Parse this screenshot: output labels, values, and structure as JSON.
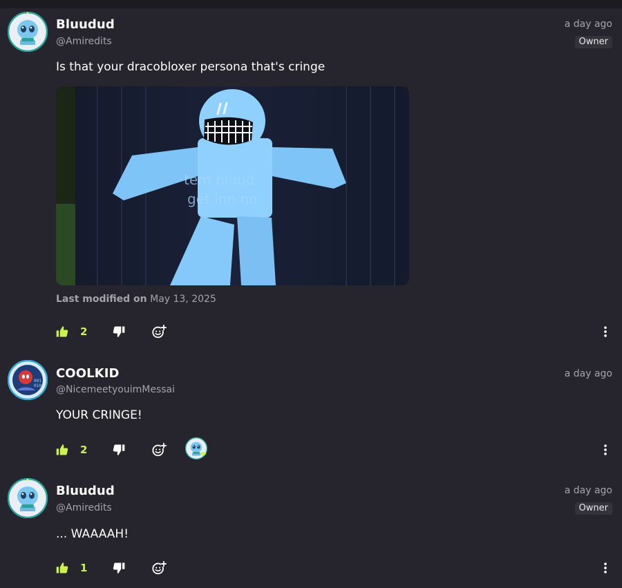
{
  "comments": [
    {
      "username": "Bluudud",
      "handle": "@Amiredits",
      "time": "a day ago",
      "badge": "Owner",
      "text": "Is that your dracobloxer persona that's cringe",
      "image_text": [
        "tem bluud",
        "get inn no"
      ],
      "modified_label": "Last modified on",
      "modified_date": "May 13, 2025",
      "likes": "2"
    },
    {
      "username": "COOLKID",
      "handle": "@NicemeetyouimMessai",
      "time": "a day ago",
      "text": "YOUR CRINGE!",
      "likes": "2"
    },
    {
      "username": "Bluudud",
      "handle": "@Amiredits",
      "time": "a day ago",
      "badge": "Owner",
      "text": "... WAAAAH!",
      "likes": "1"
    }
  ],
  "colors": {
    "background": "#26252e",
    "accent": "#ccf34a",
    "muted_text": "#a4a3ab",
    "badge_bg": "#34333c"
  },
  "icons": {
    "like": "thumbs-up-icon",
    "dislike": "thumbs-down-icon",
    "react": "add-reaction-icon",
    "more": "more-vertical-icon"
  }
}
